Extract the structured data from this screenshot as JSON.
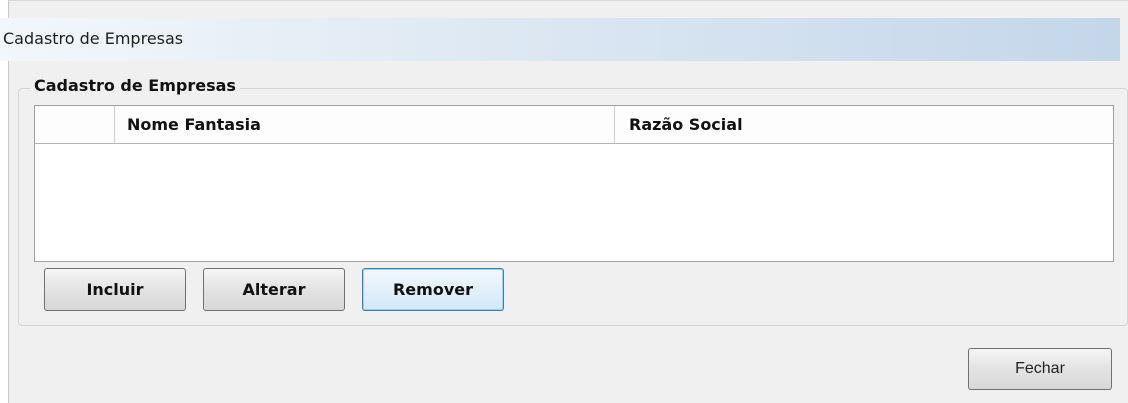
{
  "window": {
    "title": "Cadastro de Empresas"
  },
  "group": {
    "title": "Cadastro de Empresas"
  },
  "grid": {
    "columns": [
      "",
      "Nome Fantasia",
      "Razão Social"
    ],
    "rows": []
  },
  "buttons": {
    "incluir": "Incluir",
    "alterar": "Alterar",
    "remover": "Remover",
    "fechar": "Fechar"
  },
  "colors": {
    "titlebar_gradient_end": "#c4d6ea",
    "focus_border": "#3c7fb1"
  }
}
